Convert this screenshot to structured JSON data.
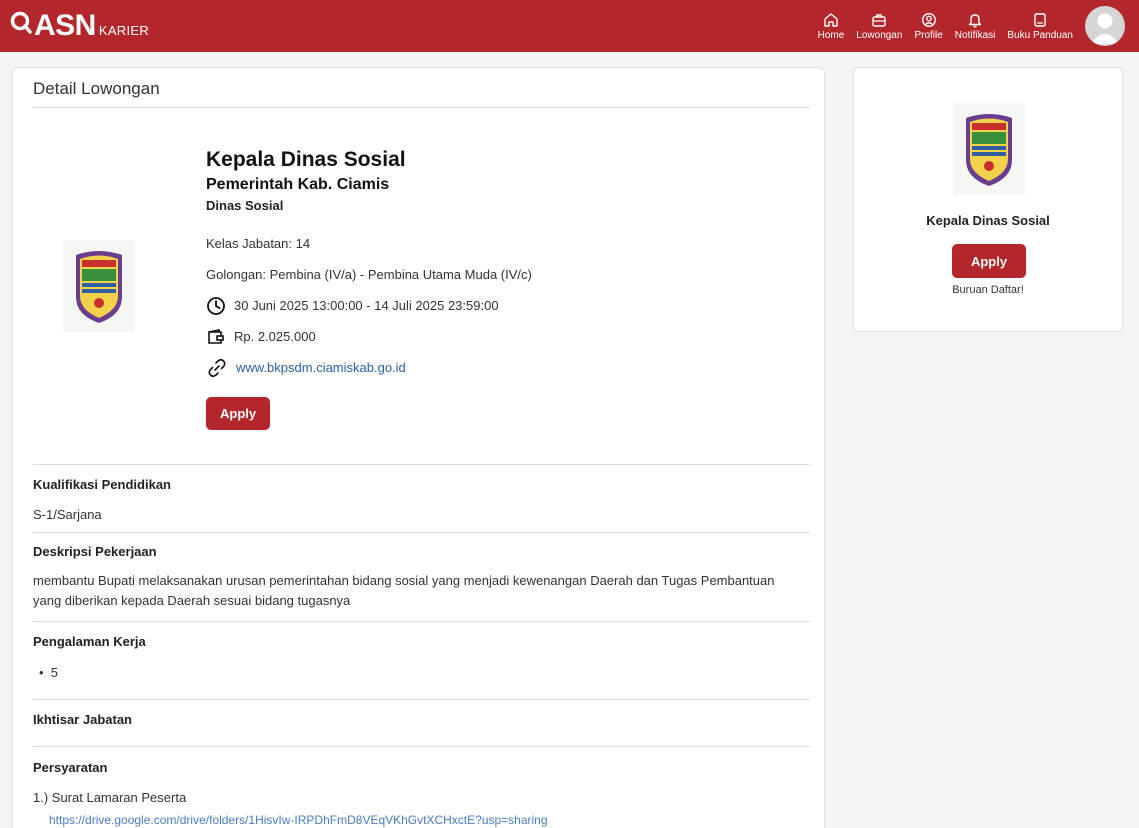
{
  "header": {
    "brand_name": "ASN",
    "brand_suffix": "KARIER",
    "nav": [
      {
        "label": "Home",
        "icon": "home-icon"
      },
      {
        "label": "Lowongan",
        "icon": "briefcase-icon"
      },
      {
        "label": "Profile",
        "icon": "user-circle-icon"
      },
      {
        "label": "Notifikasi",
        "icon": "bell-icon"
      },
      {
        "label": "Buku Panduan",
        "icon": "book-icon"
      }
    ]
  },
  "colors": {
    "brand": "#b3262b",
    "link": "#2b5fa8"
  },
  "detail": {
    "page_title": "Detail Lowongan",
    "job_title": "Kepala Dinas Sosial",
    "organization": "Pemerintah Kab. Ciamis",
    "unit": "Dinas Sosial",
    "kelas_jabatan": "Kelas Jabatan: 14",
    "golongan": "Golongan: Pembina (IV/a) - Pembina Utama Muda (IV/c)",
    "period": "30 Juni 2025 13:00:00 - 14 Juli 2025 23:59:00",
    "salary": "Rp. 2.025.000",
    "website": "www.bkpsdm.ciamiskab.go.id",
    "apply_label": "Apply"
  },
  "sections": {
    "pendidikan": {
      "title": "Kualifikasi Pendidikan",
      "body": "S-1/Sarjana"
    },
    "deskripsi": {
      "title": "Deskripsi Pekerjaan",
      "body": "membantu Bupati melaksanakan urusan pemerintahan bidang sosial yang menjadi kewenangan Daerah dan Tugas Pembantuan yang diberikan kepada Daerah sesuai bidang tugasnya"
    },
    "pengalaman": {
      "title": "Pengalaman Kerja",
      "items": [
        "5"
      ]
    },
    "ikhtisar": {
      "title": "Ikhtisar Jabatan"
    },
    "persyaratan": {
      "title": "Persyaratan",
      "item1": "1.) Surat Lamaran Peserta",
      "item1_link": "https://drive.google.com/drive/folders/1HisvIw-IRPDhFmD8VEqVKhGvtXCHxctE?usp=sharing"
    }
  },
  "side": {
    "title": "Kepala Dinas Sosial",
    "apply_label": "Apply",
    "note": "Buruan Daftar!"
  }
}
